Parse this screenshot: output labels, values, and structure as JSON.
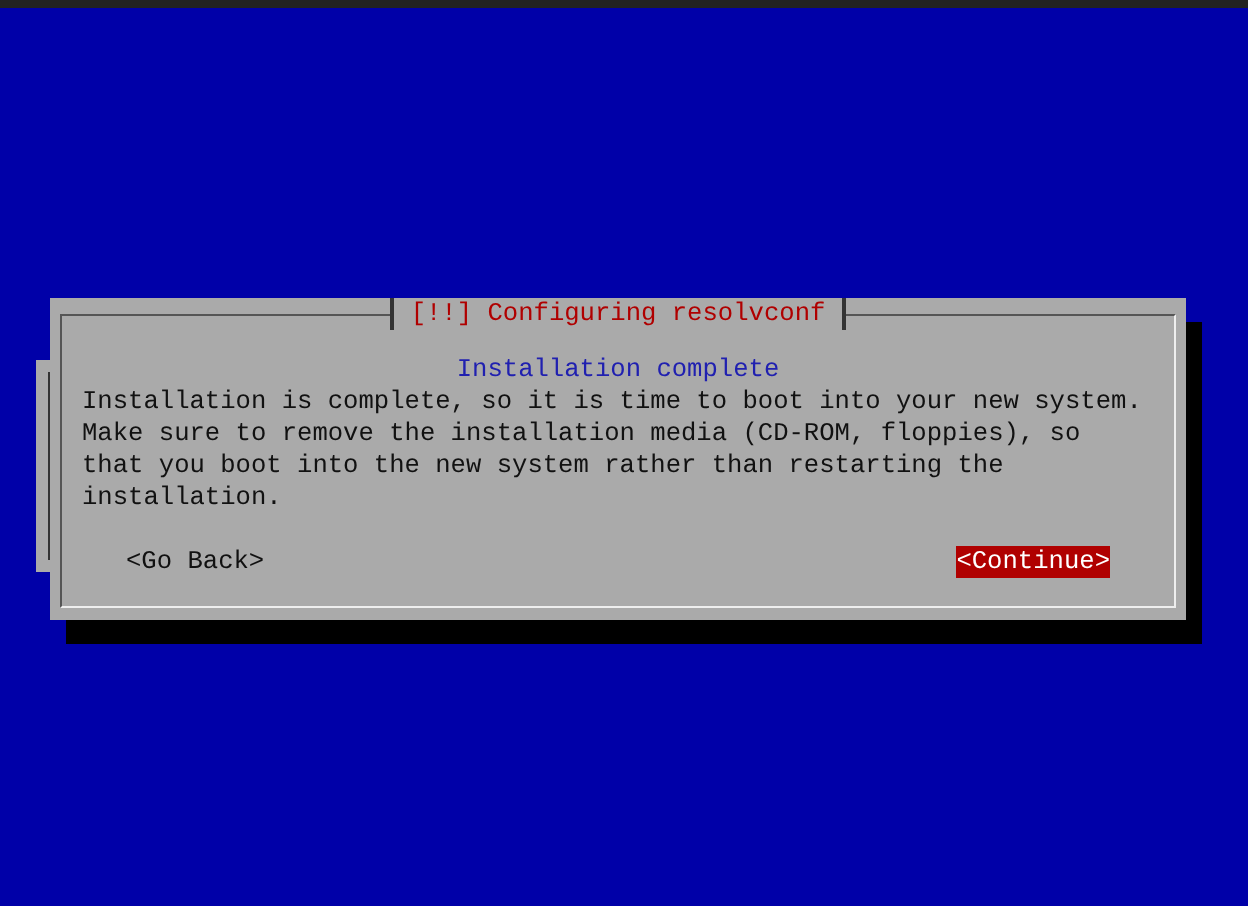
{
  "dialog": {
    "title": "[!!] Configuring resolvconf",
    "heading": "Installation complete",
    "message": [
      "Installation is complete, so it is time to boot into your new system.",
      "Make sure to remove the installation media (CD-ROM, floppies), so",
      "that you boot into the new system rather than restarting the",
      "installation."
    ],
    "buttons": [
      {
        "label": "<Go Back>",
        "selected": false
      },
      {
        "label": "<Continue>",
        "selected": true
      }
    ]
  }
}
